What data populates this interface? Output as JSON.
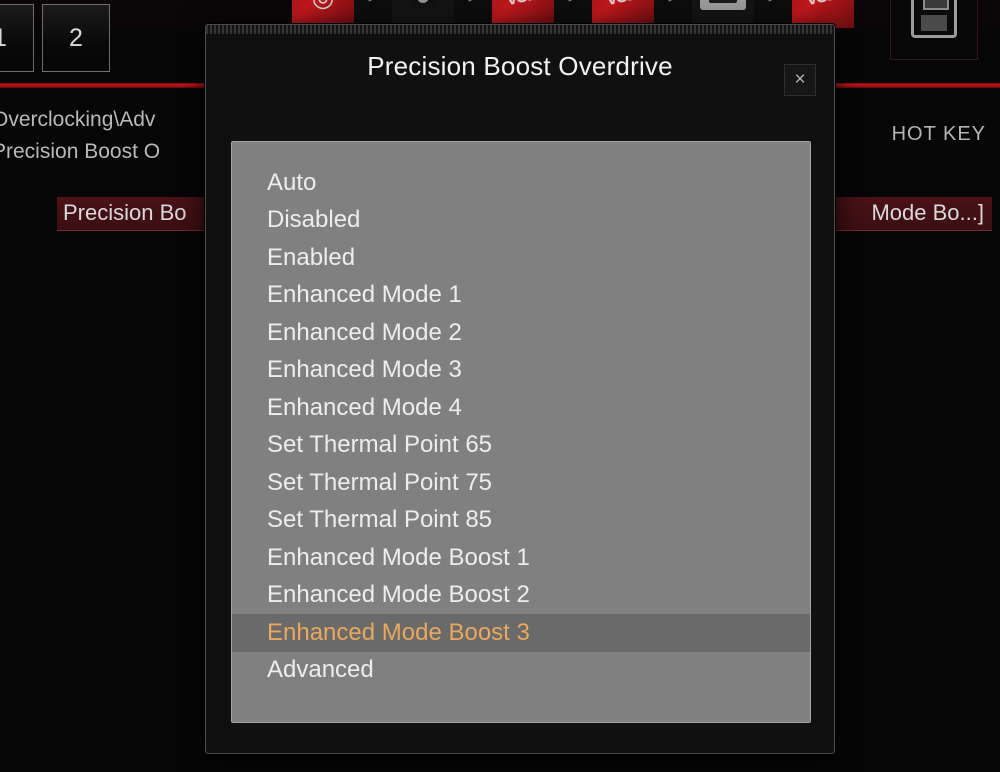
{
  "background": {
    "page_tabs": [
      "1",
      "2"
    ],
    "breadcrumb_line1": "Overclocking\\Adv",
    "breadcrumb_line2": "Precision Boost O",
    "hotkey_label": "HOT KEY",
    "selected_option_label": "Precision Bo",
    "selected_option_value": "Mode Bo...]",
    "toolbar_separator": ">",
    "toolbar_tiles": [
      "cpu-tile",
      "chevron",
      "fan-tile",
      "chevron",
      "vcb-tile",
      "chevron",
      "vcb-tile-2",
      "chevron",
      "ram-tile",
      "chevron",
      "vcb-tile-3"
    ],
    "save_icon": "monitor-save-icon",
    "accent_red": "#c4161b",
    "bar_red": "#4a1216"
  },
  "dialog": {
    "title": "Precision Boost Overdrive",
    "close_label": "×",
    "panel_bg": "#808080",
    "highlight_bg": "#6a6a6a",
    "highlight_text": "#e8a85e",
    "options": [
      {
        "label": "Auto",
        "selected": false
      },
      {
        "label": "Disabled",
        "selected": false
      },
      {
        "label": "Enabled",
        "selected": false
      },
      {
        "label": "Enhanced Mode 1",
        "selected": false
      },
      {
        "label": "Enhanced Mode 2",
        "selected": false
      },
      {
        "label": "Enhanced Mode 3",
        "selected": false
      },
      {
        "label": "Enhanced Mode 4",
        "selected": false
      },
      {
        "label": "Set Thermal Point 65",
        "selected": false
      },
      {
        "label": "Set Thermal Point 75",
        "selected": false
      },
      {
        "label": "Set Thermal Point 85",
        "selected": false
      },
      {
        "label": "Enhanced Mode Boost 1",
        "selected": false
      },
      {
        "label": "Enhanced Mode Boost 2",
        "selected": false
      },
      {
        "label": "Enhanced Mode Boost 3",
        "selected": true
      },
      {
        "label": "Advanced",
        "selected": false
      }
    ]
  }
}
